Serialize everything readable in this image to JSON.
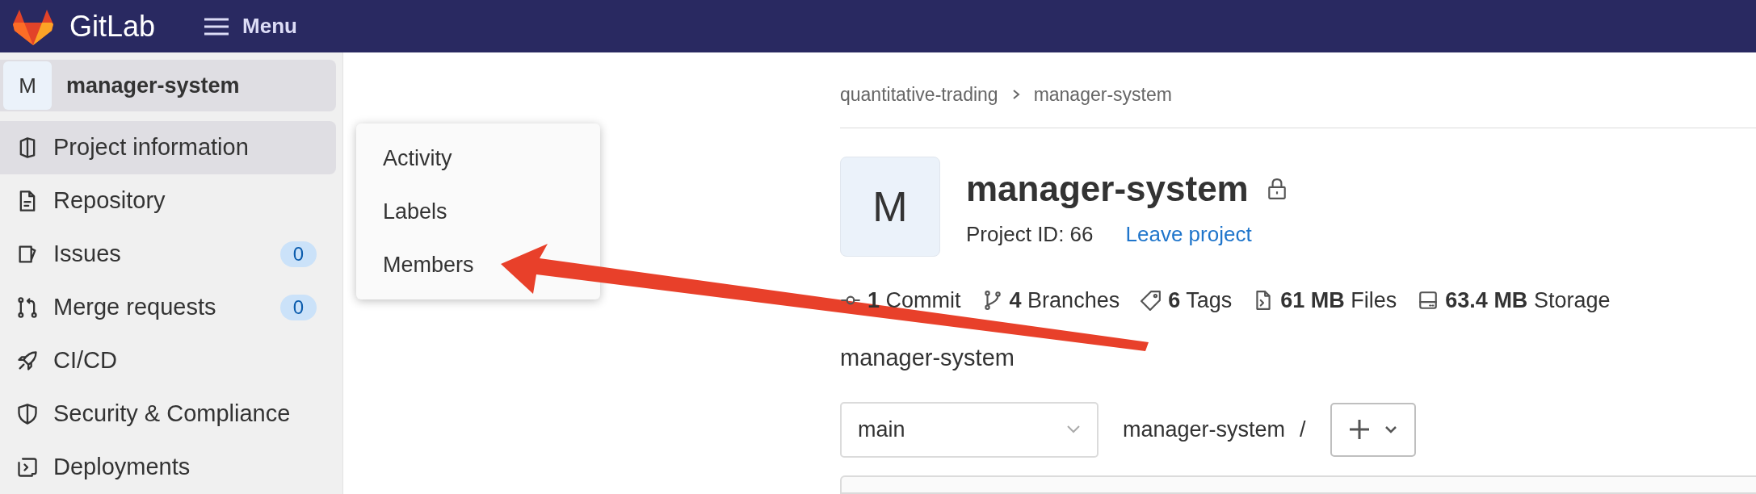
{
  "top_bar": {
    "brand": "GitLab",
    "menu": "Menu"
  },
  "sidebar": {
    "project": {
      "avatar": "M",
      "name": "manager-system"
    },
    "items": [
      {
        "label": "Project information",
        "selected": true
      },
      {
        "label": "Repository",
        "selected": false
      },
      {
        "label": "Issues",
        "selected": false,
        "count": "0"
      },
      {
        "label": "Merge requests",
        "selected": false,
        "count": "0"
      },
      {
        "label": "CI/CD",
        "selected": false
      },
      {
        "label": "Security & Compliance",
        "selected": false
      },
      {
        "label": "Deployments",
        "selected": false
      }
    ]
  },
  "flyout_menu": {
    "items": [
      "Activity",
      "Labels",
      "Members"
    ]
  },
  "breadcrumb": [
    "quantitative-trading",
    "manager-system"
  ],
  "project": {
    "avatar": "M",
    "title": "manager-system",
    "id_label": "Project ID: 66",
    "leave_link": "Leave project"
  },
  "stats": [
    {
      "value": "1",
      "label": "Commit"
    },
    {
      "value": "4",
      "label": "Branches"
    },
    {
      "value": "6",
      "label": "Tags"
    },
    {
      "value": "61 MB",
      "label": "Files"
    },
    {
      "value": "63.4 MB",
      "label": "Storage"
    }
  ],
  "description": "manager-system",
  "toolbar": {
    "branch": "main",
    "path": "manager-system",
    "separator": "/"
  }
}
